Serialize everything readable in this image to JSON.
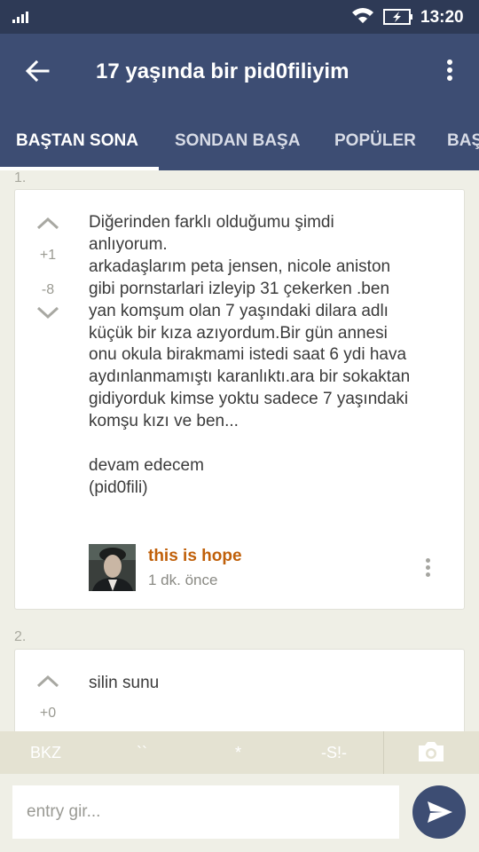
{
  "status": {
    "time": "13:20"
  },
  "header": {
    "title": "17 yaşında bir pid0filiyim"
  },
  "tabs": [
    {
      "label": "BAŞTAN SONA"
    },
    {
      "label": "SONDAN BAŞA"
    },
    {
      "label": "POPÜLER"
    },
    {
      "label": "BAŞ"
    }
  ],
  "entries": [
    {
      "index": "1.",
      "upvotes": "+1",
      "downvotes": "-8",
      "text": "Diğerinden farklı olduğumu şimdi\nanlıyorum.\narkadaşlarım peta jensen, nicole aniston\ngibi pornstarlari izleyip 31 çekerken .ben\nyan komşum olan 7 yaşındaki dilara adlı\nküçük bir kıza azıyordum.Bir gün annesi\nonu okula birakmami istedi saat 6 ydi hava\naydınlanmamıştı karanlıktı.ara bir sokaktan\ngidiyorduk kimse yoktu sadece 7 yaşındaki\nkomşu kızı ve ben...\n\ndevam edecem\n(pid0fili)",
      "author": "this is hope",
      "time_ago": "1 dk. önce"
    },
    {
      "index": "2.",
      "upvotes": "+0",
      "text": "silin sunu"
    }
  ],
  "format_bar": {
    "bkz": "BKZ",
    "backtick": "``",
    "star": "*",
    "spoiler": "-S!-"
  },
  "composer": {
    "placeholder": "entry gir..."
  },
  "colors": {
    "app_bar": "#3d4d73",
    "status_bar": "#2e3a56",
    "author": "#c0600a",
    "background": "#efefe6"
  }
}
